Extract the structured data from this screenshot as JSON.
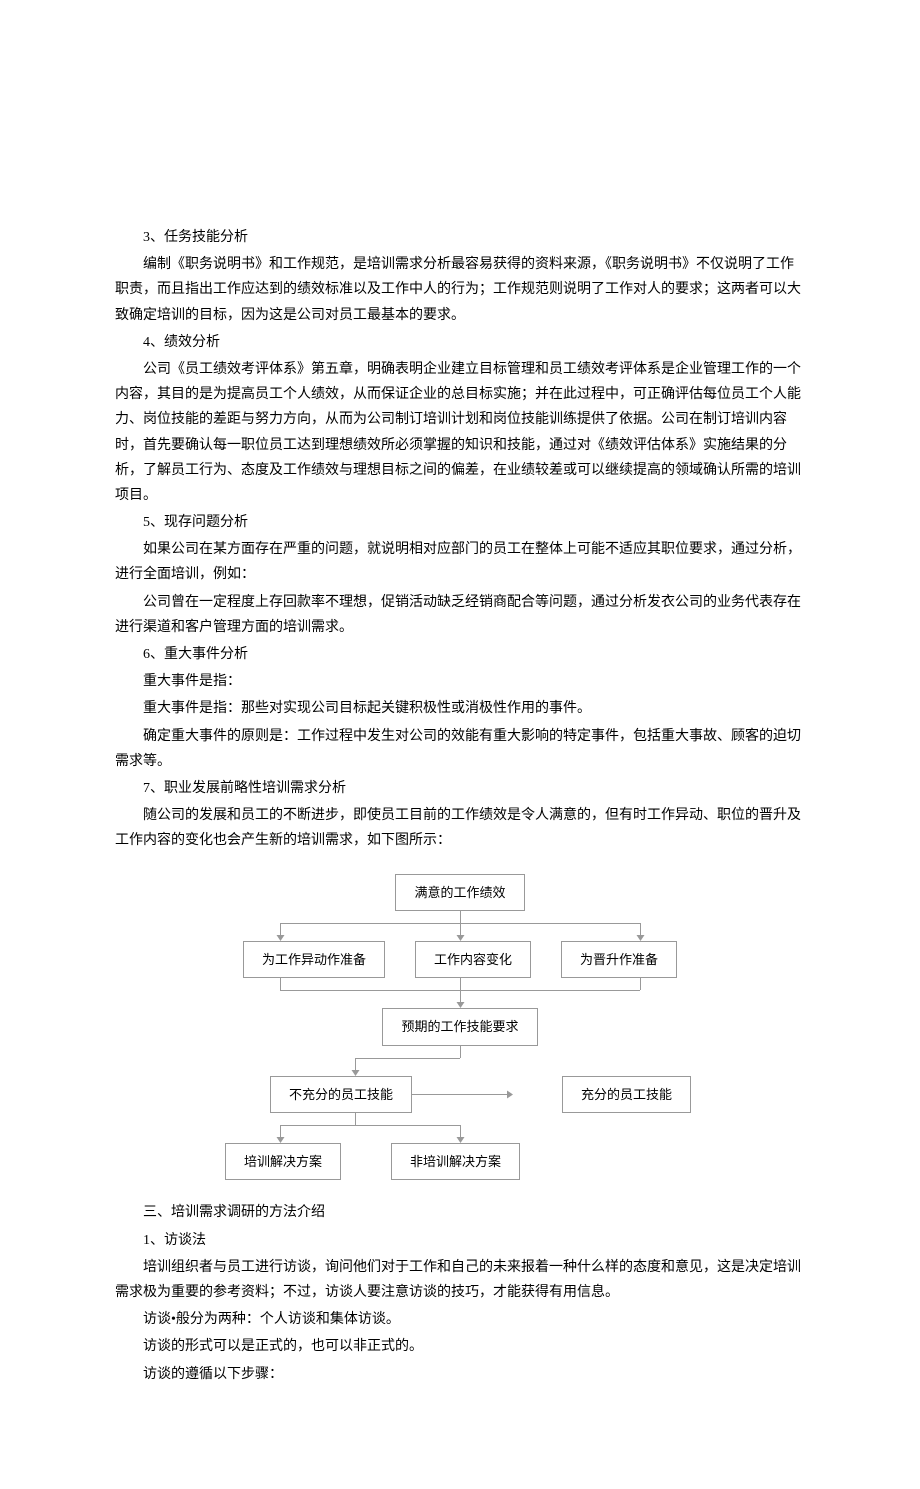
{
  "s3_num": "3、任务技能分析",
  "s3_p1": "编制《职务说明书》和工作规范，是培训需求分析最容易获得的资料来源，《职务说明书》不仅说明了工作职责，而且指出工作应达到的绩效标准以及工作中人的行为；工作规范则说明了工作对人的要求；这两者可以大致确定培训的目标，因为这是公司对员工最基本的要求。",
  "s4_num": "4、绩效分析",
  "s4_p1": "公司《员工绩效考评体系》第五章，明确表明企业建立目标管理和员工绩效考评体系是企业管理工作的一个内容，其目的是为提高员工个人绩效，从而保证企业的总目标实施；并在此过程中，可正确评估每位员工个人能力、岗位技能的差距与努力方向，从而为公司制订培训计划和岗位技能训练提供了依据。公司在制订培训内容时，首先要确认每一职位员工达到理想绩效所必须掌握的知识和技能，通过对《绩效评估体系》实施结果的分析，了解员工行为、态度及工作绩效与理想目标之间的偏差，在业绩较差或可以继续提高的领域确认所需的培训项目。",
  "s5_num": "5、现存问题分析",
  "s5_p1": "如果公司在某方面存在严重的问题，就说明相对应部门的员工在整体上可能不适应其职位要求，通过分析，进行全面培训，例如：",
  "s5_p2": "公司曾在一定程度上存回款率不理想，促销活动缺乏经销商配合等问题，通过分析发衣公司的业务代表存在进行渠道和客户管理方面的培训需求。",
  "s6_num": "6、重大事件分析",
  "s6_p1": "重大事件是指：",
  "s6_p2": "重大事件是指：那些对实现公司目标起关键积极性或消极性作用的事件。",
  "s6_p3": "确定重大事件的原则是：工作过程中发生对公司的效能有重大影响的特定事件，包括重大事故、顾客的迫切需求等。",
  "s7_num": "7、职业发展前略性培训需求分析",
  "s7_p1": "随公司的发展和员工的不断进步，即使员工目前的工作绩效是令人满意的，但有时工作异动、职位的晋升及工作内容的变化也会产生新的培训需求，如下图所示：",
  "diagram": {
    "box1": "满意的工作绩效",
    "box2a": "为工作异动作准备",
    "box2b": "工作内容变化",
    "box2c": "为晋升作准备",
    "box3": "预期的工作技能要求",
    "box4a": "不充分的员工技能",
    "box4b": "充分的员工技能",
    "box5a": "培训解决方案",
    "box5b": "非培训解决方案"
  },
  "sec3_title": "三、培训需求调研的方法介绍",
  "m1_num": "1、访谈法",
  "m1_p1": "培训组织者与员工进行访谈，询问他们对于工作和自己的未来报着一种什么样的态度和意见，这是决定培训需求极为重要的参考资料；不过，访谈人要注意访谈的技巧，才能获得有用信息。",
  "m1_p2": "访谈•般分为两种：个人访谈和集体访谈。",
  "m1_p3": "访谈的形式可以是正式的，也可以非正式的。",
  "m1_p4": "访谈的遵循以下步骤："
}
